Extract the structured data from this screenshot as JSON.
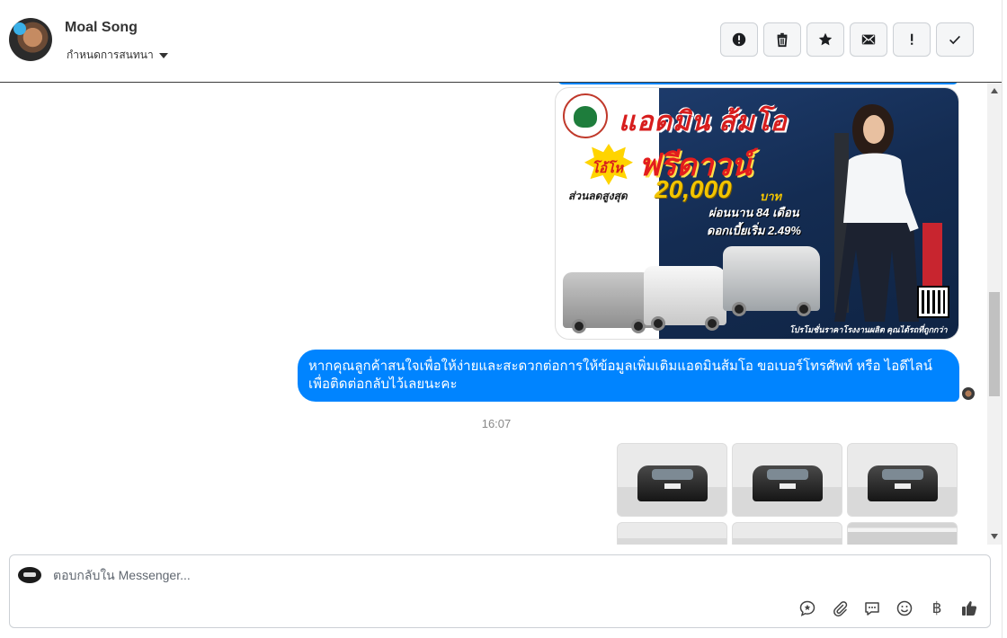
{
  "header": {
    "contact_name": "Moal Song",
    "assign_label": "กำหนดการสนทนา",
    "actions": [
      {
        "name": "report-spam-button",
        "icon": "alert-circle-icon"
      },
      {
        "name": "delete-button",
        "icon": "trash-icon"
      },
      {
        "name": "star-button",
        "icon": "star-icon"
      },
      {
        "name": "mark-unread-button",
        "icon": "mail-icon"
      },
      {
        "name": "follow-up-button",
        "icon": "exclamation-icon"
      },
      {
        "name": "mark-done-button",
        "icon": "check-icon"
      }
    ]
  },
  "promo": {
    "headline": "แอดมิน ส้มโอ",
    "burst": "โอ้โห",
    "offer": "ฟรีดาวน์",
    "discount_label": "ส่วนลดสูงสุด",
    "discount_value": "20,000",
    "discount_unit": "บาท",
    "term": "ผ่อนนาน 84 เดือน",
    "interest": "ดอกเบี้ยเริ่ม 2.49%",
    "footnote": "โปรโมชั่นราคาโรงงานผลิต คุณได้รถที่ถูกกว่า"
  },
  "messages": {
    "outgoing_text": "หากคุณลูกค้าสนใจเพื่อให้ง่ายและสะดวกต่อการให้ข้อมูลเพิ่มเติมแอดมินส้มโอ ขอเบอร์โทรศัพท์ หรือ ไอดีไลน์ เพื่อติดต่อกลับไว้เลยนะคะ",
    "timestamp": "16:07",
    "photo_count_visible": 6
  },
  "composer": {
    "placeholder": "ตอบกลับใน Messenger...",
    "value": "",
    "tools": [
      "saved-reply-icon",
      "attachment-icon",
      "chat-bubble-icon",
      "emoji-icon",
      "baht-icon",
      "like-icon"
    ],
    "baht_symbol": "฿"
  },
  "colors": {
    "accent": "#0084ff",
    "border": "#ccd0d5"
  }
}
